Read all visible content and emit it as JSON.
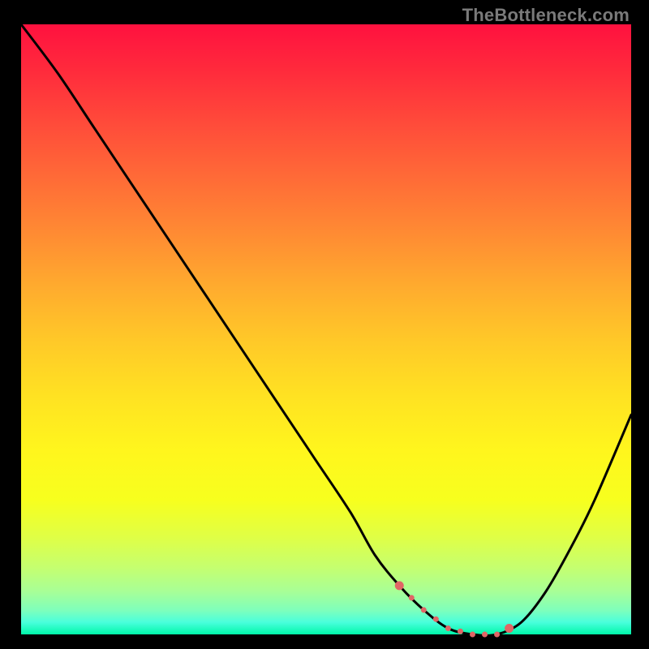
{
  "watermark": "TheBottleneck.com",
  "chart_data": {
    "type": "line",
    "title": "",
    "xlabel": "",
    "ylabel": "",
    "xlim": [
      0,
      100
    ],
    "ylim": [
      0,
      100
    ],
    "grid": false,
    "legend": false,
    "x": [
      0,
      6,
      12,
      18,
      24,
      30,
      36,
      42,
      48,
      54,
      58,
      62,
      66,
      70,
      74,
      78,
      82,
      86,
      90,
      94,
      100
    ],
    "y": [
      100,
      92,
      83,
      74,
      65,
      56,
      47,
      38,
      29,
      20,
      13,
      8,
      4,
      1,
      0,
      0,
      2,
      7,
      14,
      22,
      36
    ],
    "highlight_range": {
      "x_start": 62,
      "x_end": 80
    },
    "annotations": []
  },
  "colors": {
    "curve": "#000000",
    "highlight": "#e06666",
    "page_bg": "#000000"
  }
}
